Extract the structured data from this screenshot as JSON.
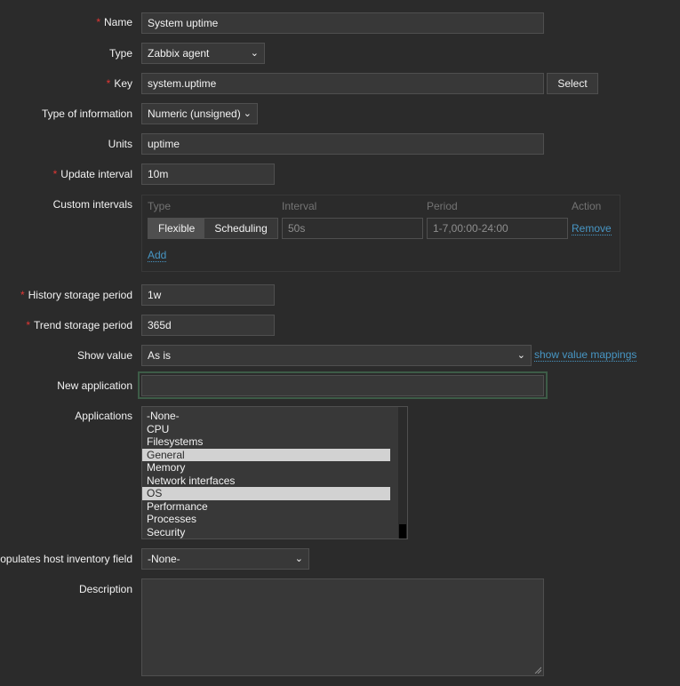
{
  "form": {
    "name": {
      "label": "Name",
      "value": "System uptime"
    },
    "type": {
      "label": "Type",
      "value": "Zabbix agent"
    },
    "key": {
      "label": "Key",
      "value": "system.uptime",
      "button": "Select"
    },
    "type_of_information": {
      "label": "Type of information",
      "value": "Numeric (unsigned)"
    },
    "units": {
      "label": "Units",
      "value": "uptime"
    },
    "update_interval": {
      "label": "Update interval",
      "value": "10m"
    },
    "custom_intervals": {
      "label": "Custom intervals",
      "headers": {
        "type": "Type",
        "interval": "Interval",
        "period": "Period",
        "action": "Action"
      },
      "row": {
        "type_options": [
          "Flexible",
          "Scheduling"
        ],
        "selected_type": "Flexible",
        "interval": "50s",
        "period": "1-7,00:00-24:00",
        "action": "Remove"
      },
      "add": "Add"
    },
    "history": {
      "label": "History storage period",
      "value": "1w"
    },
    "trend": {
      "label": "Trend storage period",
      "value": "365d"
    },
    "show_value": {
      "label": "Show value",
      "value": "As is",
      "link": "show value mappings"
    },
    "new_application": {
      "label": "New application",
      "value": ""
    },
    "applications": {
      "label": "Applications",
      "options": [
        "-None-",
        "CPU",
        "Filesystems",
        "General",
        "Memory",
        "Network interfaces",
        "OS",
        "Performance",
        "Processes",
        "Security"
      ],
      "selected": [
        "General",
        "OS"
      ]
    },
    "inventory": {
      "label": "Populates host inventory field",
      "value": "-None-"
    },
    "description": {
      "label": "Description",
      "value": ""
    }
  },
  "colors": {
    "required_asterisk": "#e33734",
    "link": "#4796c4",
    "background": "#2b2b2b",
    "focus_border": "#3d5c47"
  }
}
